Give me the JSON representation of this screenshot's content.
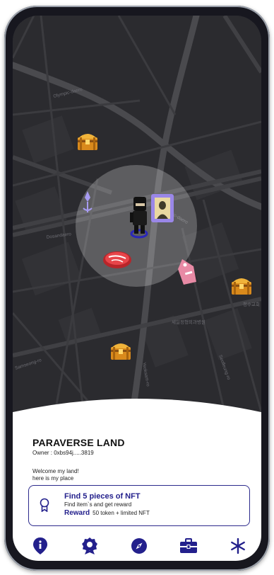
{
  "map": {
    "street_labels": [
      "Olympic-daero",
      "Dosandaero",
      "Olympic-daero",
      "Yeoksam-ro",
      "Samseong-ro",
      "Seolleung-ro",
      "세일정형외과병원",
      "청수교회"
    ]
  },
  "land": {
    "title": "PARAVERSE LAND",
    "owner": "Owner : 0xbs94j.....3819",
    "welcome": "Welcome my land!\nhere is my place"
  },
  "quest": {
    "title": "Find 5 pieces of NFT",
    "description": "Find item`s and get reward",
    "reward_label": "Reward",
    "reward_text": "50 token + limited NFT"
  },
  "nav": [
    {
      "icon": "map-pin-icon"
    },
    {
      "icon": "badge-icon"
    },
    {
      "icon": "compass-icon"
    },
    {
      "icon": "briefcase-icon"
    },
    {
      "icon": "asterisk-icon"
    }
  ],
  "colors": {
    "accent": "#23208c",
    "map_bg": "#2a2a2e",
    "road": "#454549"
  }
}
